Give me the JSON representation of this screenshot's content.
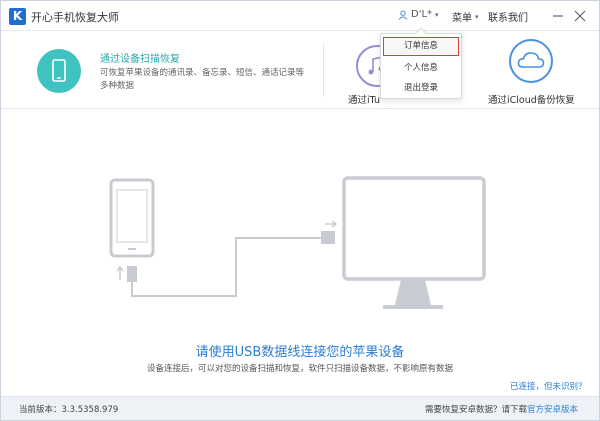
{
  "window": {
    "title": "开心手机恢复大师",
    "logo_letter": "K",
    "user_name": "D'L*",
    "menu_label": "菜单",
    "contact_label": "联系我们"
  },
  "modes": [
    {
      "title": "通过设备扫描恢复",
      "description": "可恢复苹果设备的通讯录、备忘录、短信、通话记录等多种数据",
      "icon": "phone-icon",
      "color": "#3ec3c0"
    },
    {
      "title": "通过iTu",
      "icon": "itunes-icon",
      "color": "#9b8bd6"
    },
    {
      "title": "通过iCloud备份恢复",
      "icon": "cloud-icon",
      "color": "#4d8fe0"
    }
  ],
  "dropdown": {
    "items": [
      "订单信息",
      "个人信息",
      "退出登录"
    ],
    "highlighted": "订单信息"
  },
  "content": {
    "main_title": "请使用USB数据线连接您的苹果设备",
    "sub_description": "设备连接后，可以对您的设备扫描和恢复，软件只扫描设备数据，不影响原有数据",
    "help_link": "已连接，但未识别？"
  },
  "statusbar": {
    "version_label": "当前版本：3.3.5358.979",
    "android_prefix": "需要恢复安卓数据？请下载",
    "android_link": "官方安卓版本"
  },
  "colors": {
    "accent": "#2a7fd8",
    "teal": "#3ec3c0",
    "highlight_border": "#e03a3a",
    "illustration_gray": "#c8ccd2"
  }
}
